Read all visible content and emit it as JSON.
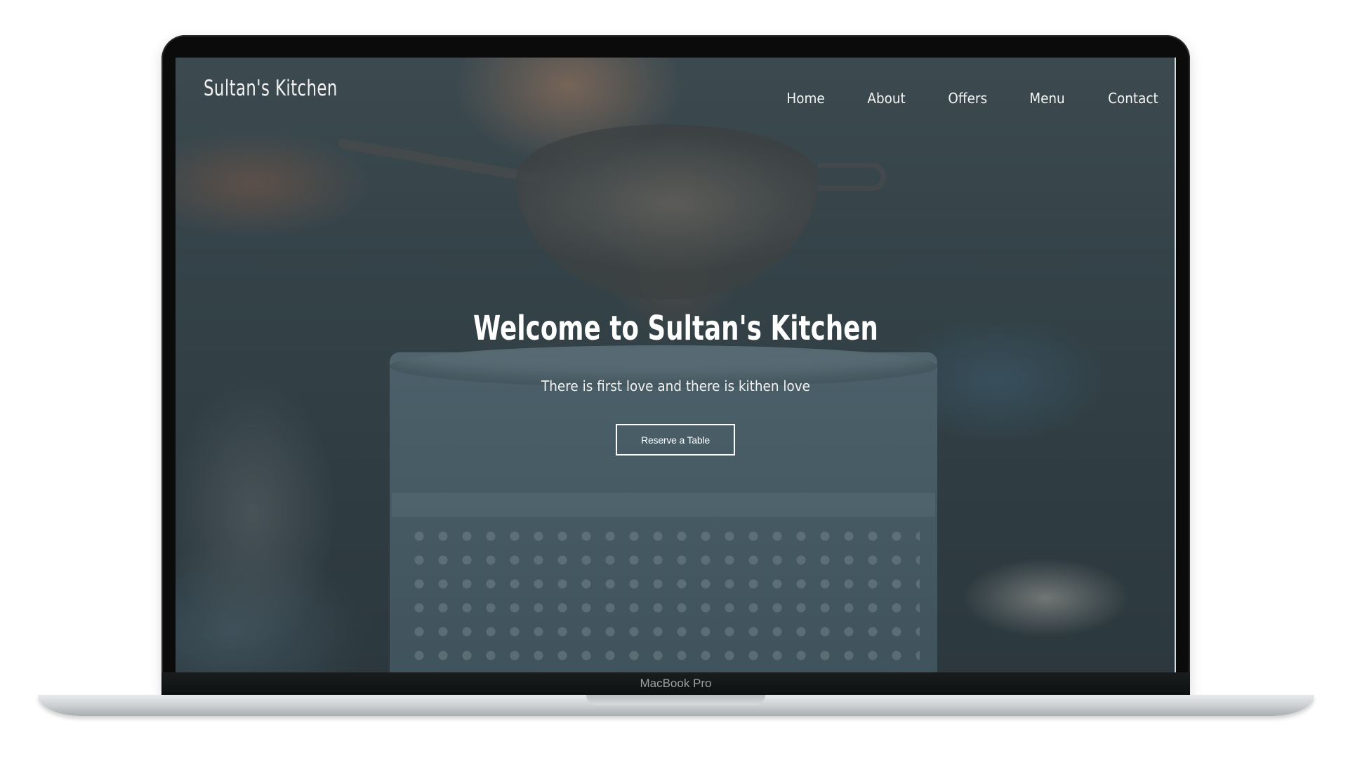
{
  "site": {
    "brand": "Sultan's Kitchen",
    "nav": {
      "items": [
        {
          "label": "Home"
        },
        {
          "label": "About"
        },
        {
          "label": "Offers"
        },
        {
          "label": "Menu"
        },
        {
          "label": "Contact"
        }
      ]
    },
    "hero": {
      "title": "Welcome to Sultan's Kitchen",
      "subtitle": "There is first love and there is kithen love",
      "cta_label": "Reserve a Table"
    }
  },
  "device": {
    "model_label": "MacBook Pro"
  },
  "colors": {
    "text": "#ffffff",
    "bezel": "#0b0b0b",
    "overlay": "#19232880"
  }
}
